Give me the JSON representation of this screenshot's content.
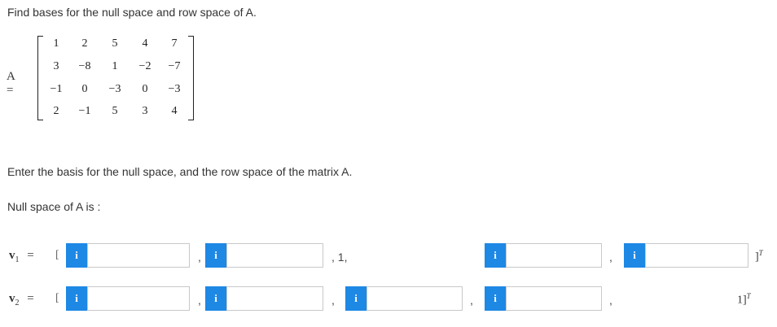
{
  "prompt": "Find bases for the null space and row space of A.",
  "matrix": {
    "label": "A =",
    "rows": [
      [
        "1",
        "2",
        "5",
        "4",
        "7"
      ],
      [
        "3",
        "−8",
        "1",
        "−2",
        "−7"
      ],
      [
        "−1",
        "0",
        "−3",
        "0",
        "−3"
      ],
      [
        "2",
        "−1",
        "5",
        "3",
        "4"
      ]
    ]
  },
  "instructions": "Enter the basis for the null space, and the row space of the matrix A.",
  "null_space_label": "Null space of A is :",
  "vectors": [
    {
      "name": "v",
      "subscript": "1",
      "equals": "=",
      "open_bracket": "[",
      "fields": [
        {
          "icon": "i",
          "value": ""
        },
        {
          "icon": "i",
          "value": ""
        },
        {
          "icon": "i",
          "value": ""
        },
        {
          "icon": "i",
          "value": ""
        }
      ],
      "separators": [
        ",",
        ", 1,",
        ","
      ],
      "closing": "]",
      "closing_sup": "T"
    },
    {
      "name": "v",
      "subscript": "2",
      "equals": "=",
      "open_bracket": "[",
      "fields": [
        {
          "icon": "i",
          "value": ""
        },
        {
          "icon": "i",
          "value": ""
        },
        {
          "icon": "i",
          "value": ""
        },
        {
          "icon": "i",
          "value": ""
        }
      ],
      "separators": [
        ",",
        ",",
        ",",
        ","
      ],
      "closing": "1]",
      "closing_sup": "T"
    }
  ],
  "colors": {
    "info_icon": "#1e88e5",
    "input_border": "#c8c8c8"
  }
}
